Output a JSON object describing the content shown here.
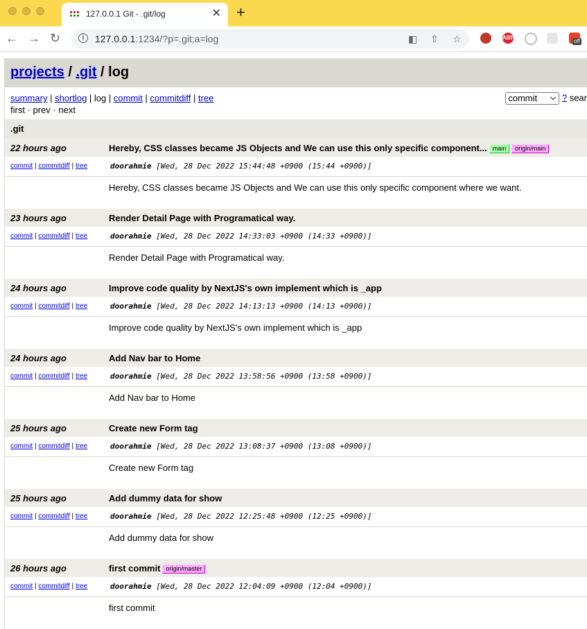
{
  "browser": {
    "tab_title": "127.0.0.1 Git - .git/log",
    "tab_close": "✕",
    "new_tab": "+",
    "url_host": "127.0.0.1",
    "url_rest": ":1234/?p=.git;a=log",
    "ext_abp": "ABP",
    "ext_off": "off"
  },
  "header": {
    "projects": "projects",
    "sep1": " / ",
    "repo": ".git",
    "sep2": " / log"
  },
  "nav": {
    "summary": "summary",
    "shortlog": "shortlog",
    "log": "log",
    "commit": "commit",
    "commitdiff": "commitdiff",
    "tree": "tree",
    "sep": " | ",
    "first": "first",
    "prev": "prev",
    "next": "next",
    "dot": " · "
  },
  "search": {
    "select_value": "commit",
    "help": "?",
    "label": "sear"
  },
  "repo_title": ".git",
  "commit_links": {
    "commit": "commit",
    "commitdiff": "commitdiff",
    "tree": "tree",
    "sep": " | "
  },
  "commits": [
    {
      "age": "22 hours ago",
      "title": "Hereby, CSS classes became JS Objects and We can use this only specific component...",
      "refs": [
        {
          "label": "main",
          "kind": "head"
        },
        {
          "label": "origin/main",
          "kind": "remote"
        }
      ],
      "author": "doorahmie",
      "date": "[Wed, 28 Dec 2022 15:44:48 +0900 (15:44 +0900)]",
      "message": "Hereby, CSS classes became JS Objects and We can use this only specific component where we want."
    },
    {
      "age": "23 hours ago",
      "title": "Render Detail Page with Programatical way.",
      "refs": [],
      "author": "doorahmie",
      "date": "[Wed, 28 Dec 2022 14:33:03 +0900 (14:33 +0900)]",
      "message": "Render Detail Page with Programatical way."
    },
    {
      "age": "24 hours ago",
      "title": "Improve code quality by NextJS's own implement which is _app",
      "refs": [],
      "author": "doorahmie",
      "date": "[Wed, 28 Dec 2022 14:13:13 +0900 (14:13 +0900)]",
      "message": "Improve code quality by NextJS's own implement which is _app"
    },
    {
      "age": "24 hours ago",
      "title": "Add Nav bar to Home",
      "refs": [],
      "author": "doorahmie",
      "date": "[Wed, 28 Dec 2022 13:58:56 +0900 (13:58 +0900)]",
      "message": "Add Nav bar to Home"
    },
    {
      "age": "25 hours ago",
      "title": "Create new Form tag",
      "refs": [],
      "author": "doorahmie",
      "date": "[Wed, 28 Dec 2022 13:08:37 +0900 (13:08 +0900)]",
      "message": "Create new Form tag"
    },
    {
      "age": "25 hours ago",
      "title": "Add dummy data for show",
      "refs": [],
      "author": "doorahmie",
      "date": "[Wed, 28 Dec 2022 12:25:48 +0900 (12:25 +0900)]",
      "message": "Add dummy data for show"
    },
    {
      "age": "26 hours ago",
      "title": "first commit",
      "refs": [
        {
          "label": "origin/master",
          "kind": "remote"
        }
      ],
      "author": "doorahmie",
      "date": "[Wed, 28 Dec 2022 12:04:09 +0900 (12:04 +0900)]",
      "message": "first commit"
    }
  ]
}
